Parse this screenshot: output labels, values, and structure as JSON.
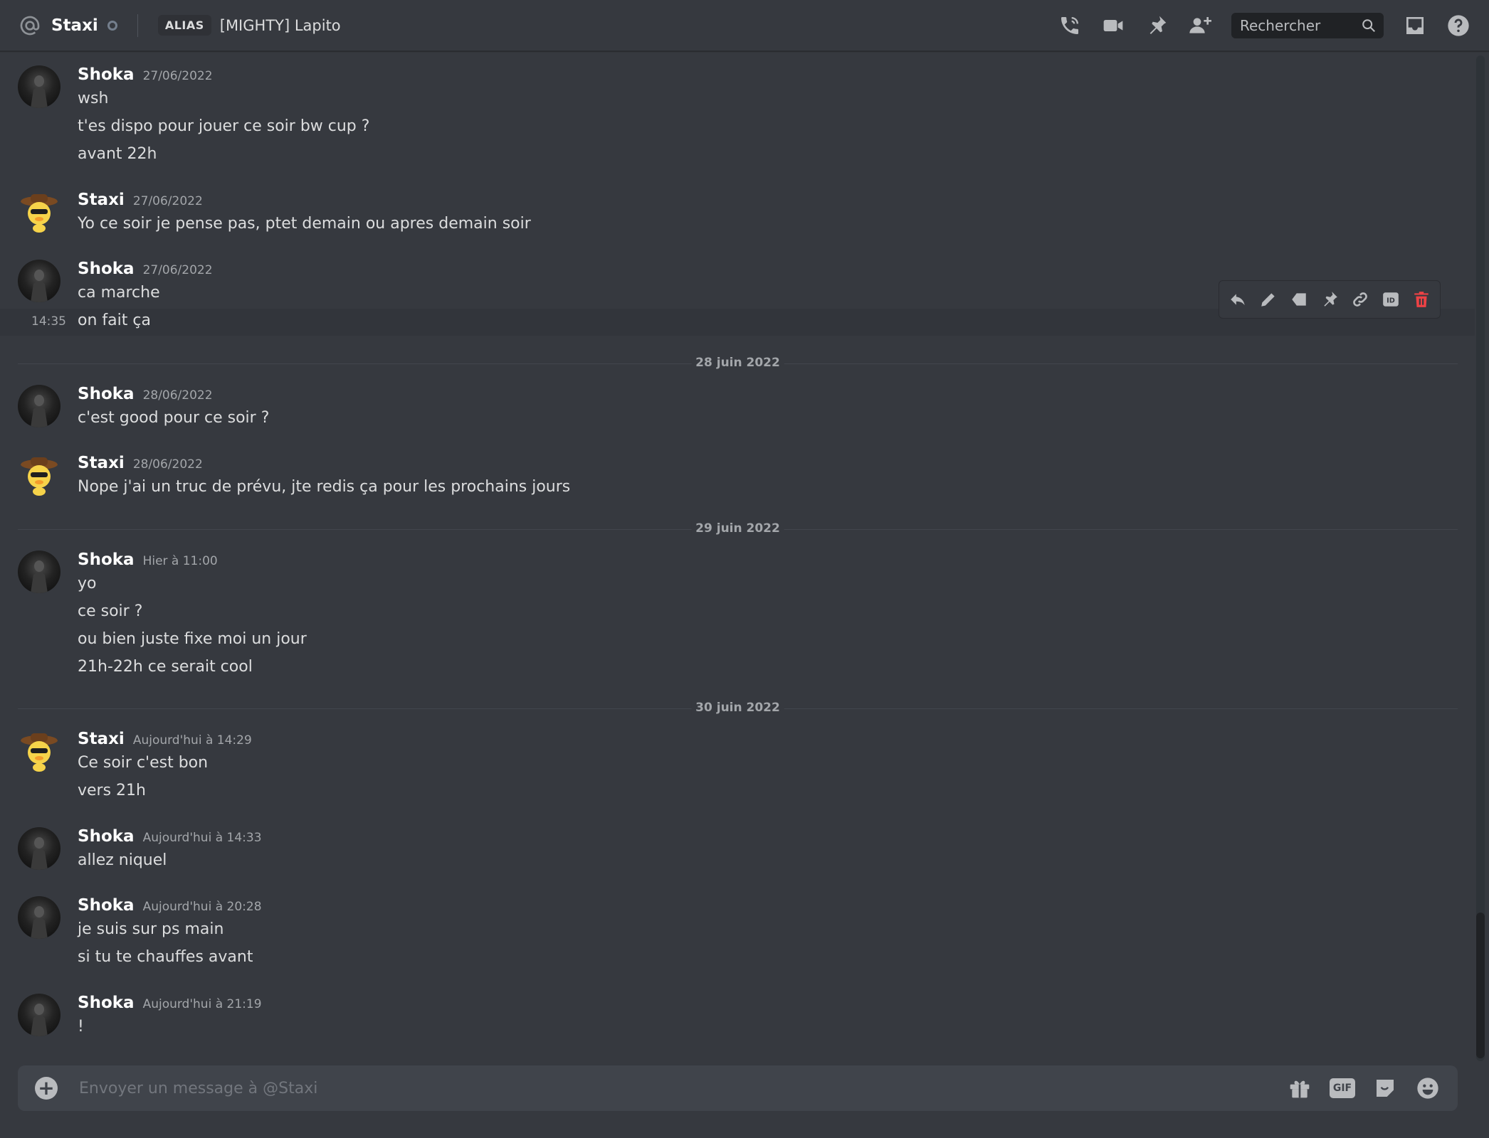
{
  "header": {
    "name": "Staxi",
    "alias_label": "ALIAS",
    "alias_value": "[MIGHTY] Lapito",
    "search_placeholder": "Rechercher"
  },
  "icons": {
    "header": [
      "at-icon",
      "status-offline-icon",
      "voice-call-icon",
      "video-call-icon",
      "pinned-messages-icon",
      "add-friend-icon",
      "search-icon",
      "inbox-icon",
      "help-icon"
    ],
    "toolbar": [
      "reply-icon",
      "edit-icon",
      "mark-unread-icon",
      "pin-icon",
      "copy-link-icon",
      "copy-id-icon",
      "delete-icon"
    ],
    "composer": [
      "add-attachment-icon",
      "gift-icon",
      "gif-icon",
      "sticker-icon",
      "emoji-icon"
    ]
  },
  "colors": {
    "background": "#36393f",
    "danger": "#ed4245",
    "hover_row": "#32353b"
  },
  "messages": [
    {
      "author": "Shoka",
      "timestamp": "27/06/2022",
      "lines": [
        "wsh",
        "t'es dispo pour jouer ce soir bw cup ?",
        "avant 22h"
      ]
    },
    {
      "author": "Staxi",
      "timestamp": "27/06/2022",
      "lines": [
        "Yo ce soir je pense pas, ptet demain ou apres demain soir"
      ]
    },
    {
      "author": "Shoka",
      "timestamp": "27/06/2022",
      "lines": [
        "ca marche",
        "on fait ça"
      ],
      "hover_time": "14:35"
    },
    {
      "author": "Shoka",
      "timestamp": "28/06/2022",
      "lines": [
        "c'est good pour ce soir ?"
      ]
    },
    {
      "author": "Staxi",
      "timestamp": "28/06/2022",
      "lines": [
        "Nope j'ai un truc de prévu, jte redis ça pour les prochains jours"
      ]
    },
    {
      "author": "Shoka",
      "timestamp": "Hier à 11:00",
      "lines": [
        "yo",
        "ce soir ?",
        "ou bien juste fixe moi un jour",
        "21h-22h ce serait cool"
      ]
    },
    {
      "author": "Staxi",
      "timestamp": "Aujourd'hui à 14:29",
      "lines": [
        "Ce soir c'est bon",
        "vers 21h"
      ]
    },
    {
      "author": "Shoka",
      "timestamp": "Aujourd'hui à 14:33",
      "lines": [
        "allez niquel"
      ]
    },
    {
      "author": "Shoka",
      "timestamp": "Aujourd'hui à 20:28",
      "lines": [
        "je suis sur ps main",
        "si tu te chauffes avant"
      ]
    },
    {
      "author": "Shoka",
      "timestamp": "Aujourd'hui à 21:19",
      "lines": [
        "!"
      ]
    }
  ],
  "dividers": [
    "28 juin 2022",
    "29 juin 2022",
    "30 juin 2022"
  ],
  "composer": {
    "placeholder": "Envoyer un message à @Staxi",
    "gif_label": "GIF"
  },
  "toolbar": {
    "id_label": "ID"
  }
}
